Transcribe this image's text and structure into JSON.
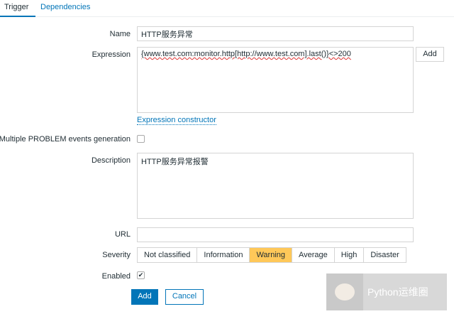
{
  "tabs": [
    {
      "label": "Trigger",
      "active": true
    },
    {
      "label": "Dependencies",
      "active": false
    }
  ],
  "form": {
    "name": {
      "label": "Name",
      "value": "HTTP服务异常"
    },
    "expression": {
      "label": "Expression",
      "value": "{www.test.com:monitor.http[http://www.test.com].last()}<>200",
      "add_label": "Add",
      "constructor_link": "Expression constructor"
    },
    "multiple": {
      "label": "Multiple PROBLEM events generation",
      "checked": false
    },
    "description": {
      "label": "Description",
      "value": "HTTP服务异常报警"
    },
    "url": {
      "label": "URL",
      "value": ""
    },
    "severity": {
      "label": "Severity",
      "options": [
        "Not classified",
        "Information",
        "Warning",
        "Average",
        "High",
        "Disaster"
      ],
      "selected": "Warning"
    },
    "enabled": {
      "label": "Enabled",
      "checked": true,
      "mark": "✔"
    },
    "add_label": "Add",
    "cancel_label": "Cancel"
  },
  "watermark": "Python运维圈",
  "colors": {
    "accent": "#0275b8",
    "selected": "#ffc859"
  }
}
